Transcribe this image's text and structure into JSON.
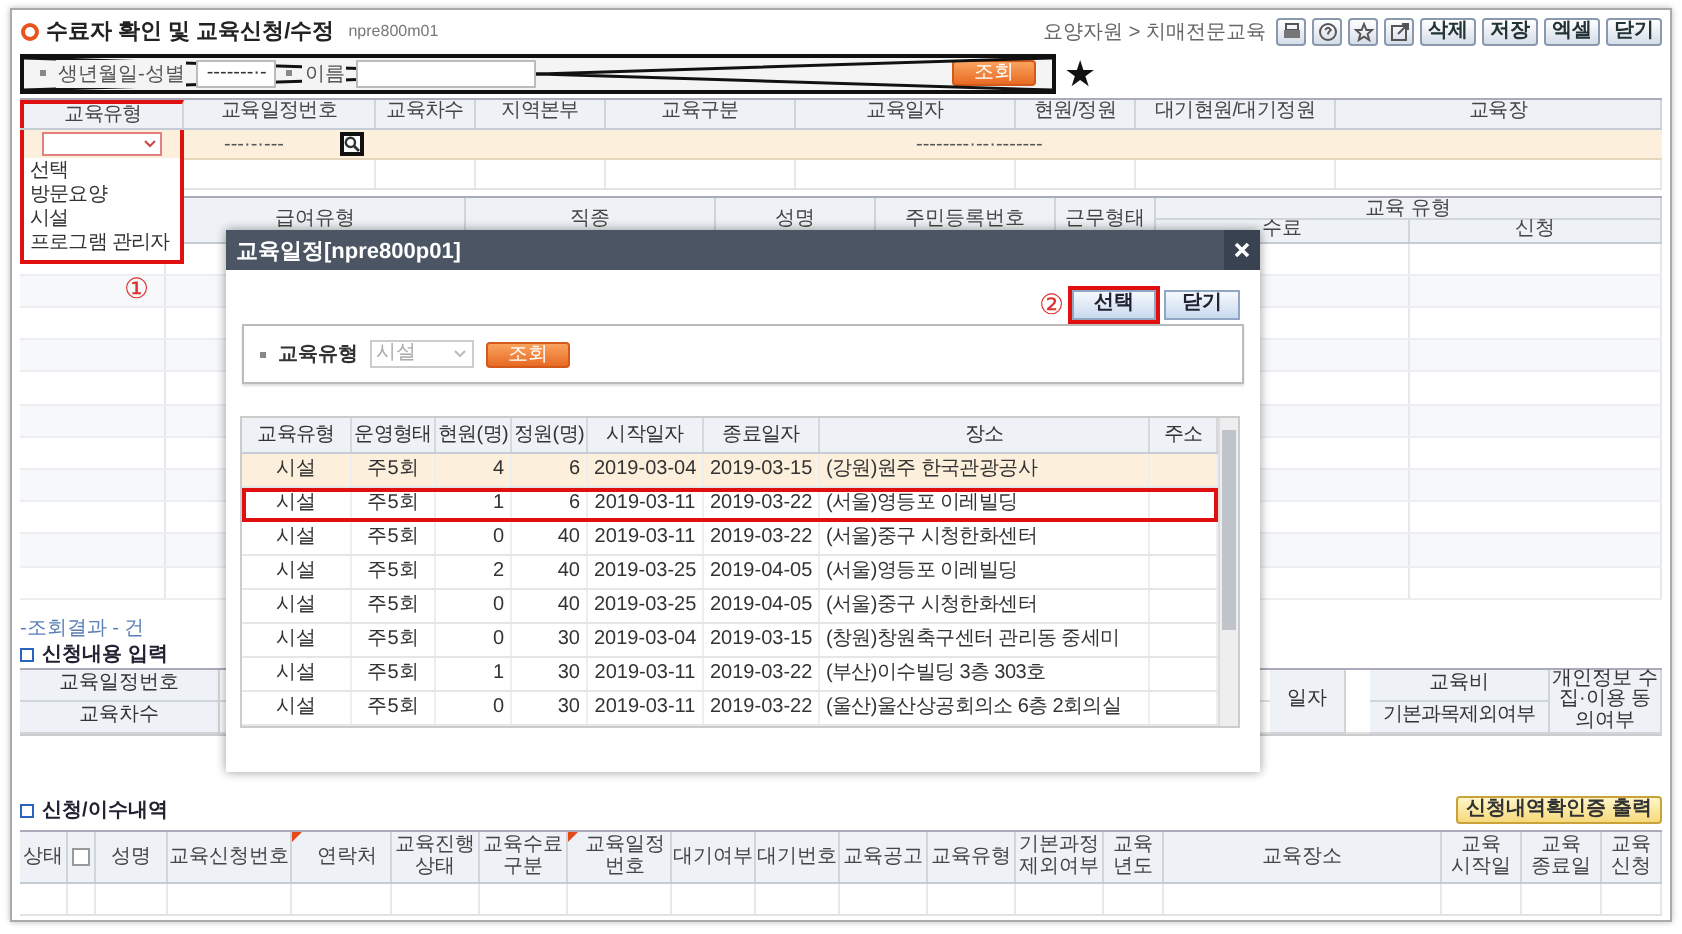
{
  "header": {
    "title": "수료자 확인 및 교육신청/수정",
    "screen_id": "npre800m01",
    "breadcrumb": "요양자원 > 치매전문교육",
    "tool_buttons": [
      "삭제",
      "저장",
      "엑셀",
      "닫기"
    ]
  },
  "search": {
    "crossed_out": true,
    "birth_label": "생년월일-성별",
    "birth_value": "-------·-",
    "name_label": "이름",
    "button": "조회"
  },
  "star": "★",
  "schedule_table": {
    "columns": [
      "교육유형",
      "교육일정번호",
      "교육차수",
      "지역본부",
      "교육구분",
      "교육일자",
      "현원/정원",
      "대기현원/대기정원",
      "교육장"
    ],
    "schedule_no": "---·-·---",
    "date_range": "--------·--·-------",
    "search_outlined": true
  },
  "type_dropdown": {
    "highlighted": true,
    "marker": "①",
    "options": [
      {
        "label": "선택"
      },
      {
        "label": "방문요양"
      },
      {
        "label": "시설"
      },
      {
        "label": "프로그램 관리자"
      }
    ]
  },
  "staff_table": {
    "columns": [
      "급여유형",
      "직종",
      "성명",
      "주민등록번호",
      "근무형태"
    ],
    "group": "교육 유형",
    "group_columns": [
      "수료",
      "신청"
    ]
  },
  "result_count": "-조회결과 - 건",
  "application": {
    "title": "신청내용 입력",
    "left_labels": [
      "교육일정번호",
      "교육차수"
    ],
    "date_label": "일자",
    "fee_label": "교육비",
    "consent_label": "개인정보 수집·이용 동의여부",
    "exclude_label": "기본과목제외여부"
  },
  "history": {
    "title": "신청/이수내역",
    "print_button": "신청내역확인증 출력",
    "select_all_checked": false,
    "columns": [
      {
        "kind": "text",
        "label": "상태",
        "required": false
      },
      {
        "kind": "checkbox",
        "required": false
      },
      {
        "kind": "text",
        "label": "성명",
        "required": false
      },
      {
        "kind": "text",
        "label": "교육신청번호",
        "required": false
      },
      {
        "kind": "text",
        "label": "연락처",
        "required": true
      },
      {
        "kind": "text",
        "label": "교육진행 상태",
        "required": false
      },
      {
        "kind": "text",
        "label": "교육수료 구분",
        "required": false
      },
      {
        "kind": "text",
        "label": "교육일정 번호",
        "required": true
      },
      {
        "kind": "text",
        "label": "대기여부",
        "required": false
      },
      {
        "kind": "text",
        "label": "대기번호",
        "required": false
      },
      {
        "kind": "text",
        "label": "교육공고",
        "required": false
      },
      {
        "kind": "text",
        "label": "교육유형",
        "required": false
      },
      {
        "kind": "text",
        "label": "기본과정 제외여부",
        "required": false
      },
      {
        "kind": "text",
        "label": "교육 년도",
        "required": false
      },
      {
        "kind": "text",
        "label": "교육장소",
        "required": false
      },
      {
        "kind": "text",
        "label": "교육 시작일",
        "required": false
      },
      {
        "kind": "text",
        "label": "교육 종료일",
        "required": false
      },
      {
        "kind": "text",
        "label": "교육 신청",
        "required": false
      }
    ]
  },
  "modal": {
    "title": "교육일정[npre800p01]",
    "marker": "②",
    "buttons": [
      {
        "label": "선택",
        "highlighted": true
      },
      {
        "label": "닫기",
        "highlighted": false
      }
    ],
    "filter_label": "교육유형",
    "filter_value": "시설",
    "filter_button": "조회",
    "columns": [
      "교육유형",
      "운영형태",
      "현원(명)",
      "정원(명)",
      "시작일자",
      "종료일자",
      "장소",
      "주소"
    ],
    "rows": [
      {
        "cells": [
          "시설",
          "주5회",
          "4",
          "6",
          "2019-03-04",
          "2019-03-15",
          "(강원)원주 한국관광공사"
        ],
        "current": true,
        "selected": false
      },
      {
        "cells": [
          "시설",
          "주5회",
          "1",
          "6",
          "2019-03-11",
          "2019-03-22",
          "(서울)영등포 이레빌딩"
        ],
        "current": false,
        "selected": true
      },
      {
        "cells": [
          "시설",
          "주5회",
          "0",
          "40",
          "2019-03-11",
          "2019-03-22",
          "(서울)중구 시청한화센터"
        ],
        "current": false,
        "selected": false
      },
      {
        "cells": [
          "시설",
          "주5회",
          "2",
          "40",
          "2019-03-25",
          "2019-04-05",
          "(서울)영등포 이레빌딩"
        ],
        "current": false,
        "selected": false
      },
      {
        "cells": [
          "시설",
          "주5회",
          "0",
          "40",
          "2019-03-25",
          "2019-04-05",
          "(서울)중구 시청한화센터"
        ],
        "current": false,
        "selected": false
      },
      {
        "cells": [
          "시설",
          "주5회",
          "0",
          "30",
          "2019-03-04",
          "2019-03-15",
          "(창원)창원축구센터 관리동 중세미"
        ],
        "current": false,
        "selected": false
      },
      {
        "cells": [
          "시설",
          "주5회",
          "1",
          "30",
          "2019-03-11",
          "2019-03-22",
          "(부산)이수빌딩 3층 303호"
        ],
        "current": false,
        "selected": false
      },
      {
        "cells": [
          "시설",
          "주5회",
          "0",
          "30",
          "2019-03-11",
          "2019-03-22",
          "(울산)울산상공회의소 6층 2회의실"
        ],
        "current": false,
        "selected": false
      }
    ]
  }
}
